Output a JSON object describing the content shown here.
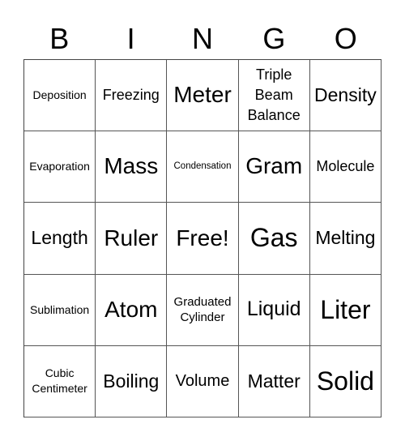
{
  "header": {
    "letters": [
      "B",
      "I",
      "N",
      "G",
      "O"
    ]
  },
  "board": {
    "cells": [
      [
        "Deposition",
        "Freezing",
        "Meter",
        "Triple Beam Balance",
        "Density"
      ],
      [
        "Evaporation",
        "Mass",
        "Condensation",
        "Gram",
        "Molecule"
      ],
      [
        "Length",
        "Ruler",
        "Free!",
        "Gas",
        "Melting"
      ],
      [
        "Sublimation",
        "Atom",
        "Graduated Cylinder",
        "Liquid",
        "Liter"
      ],
      [
        "Cubic Centimeter",
        "Boiling",
        "Volume",
        "Matter",
        "Solid"
      ]
    ]
  }
}
